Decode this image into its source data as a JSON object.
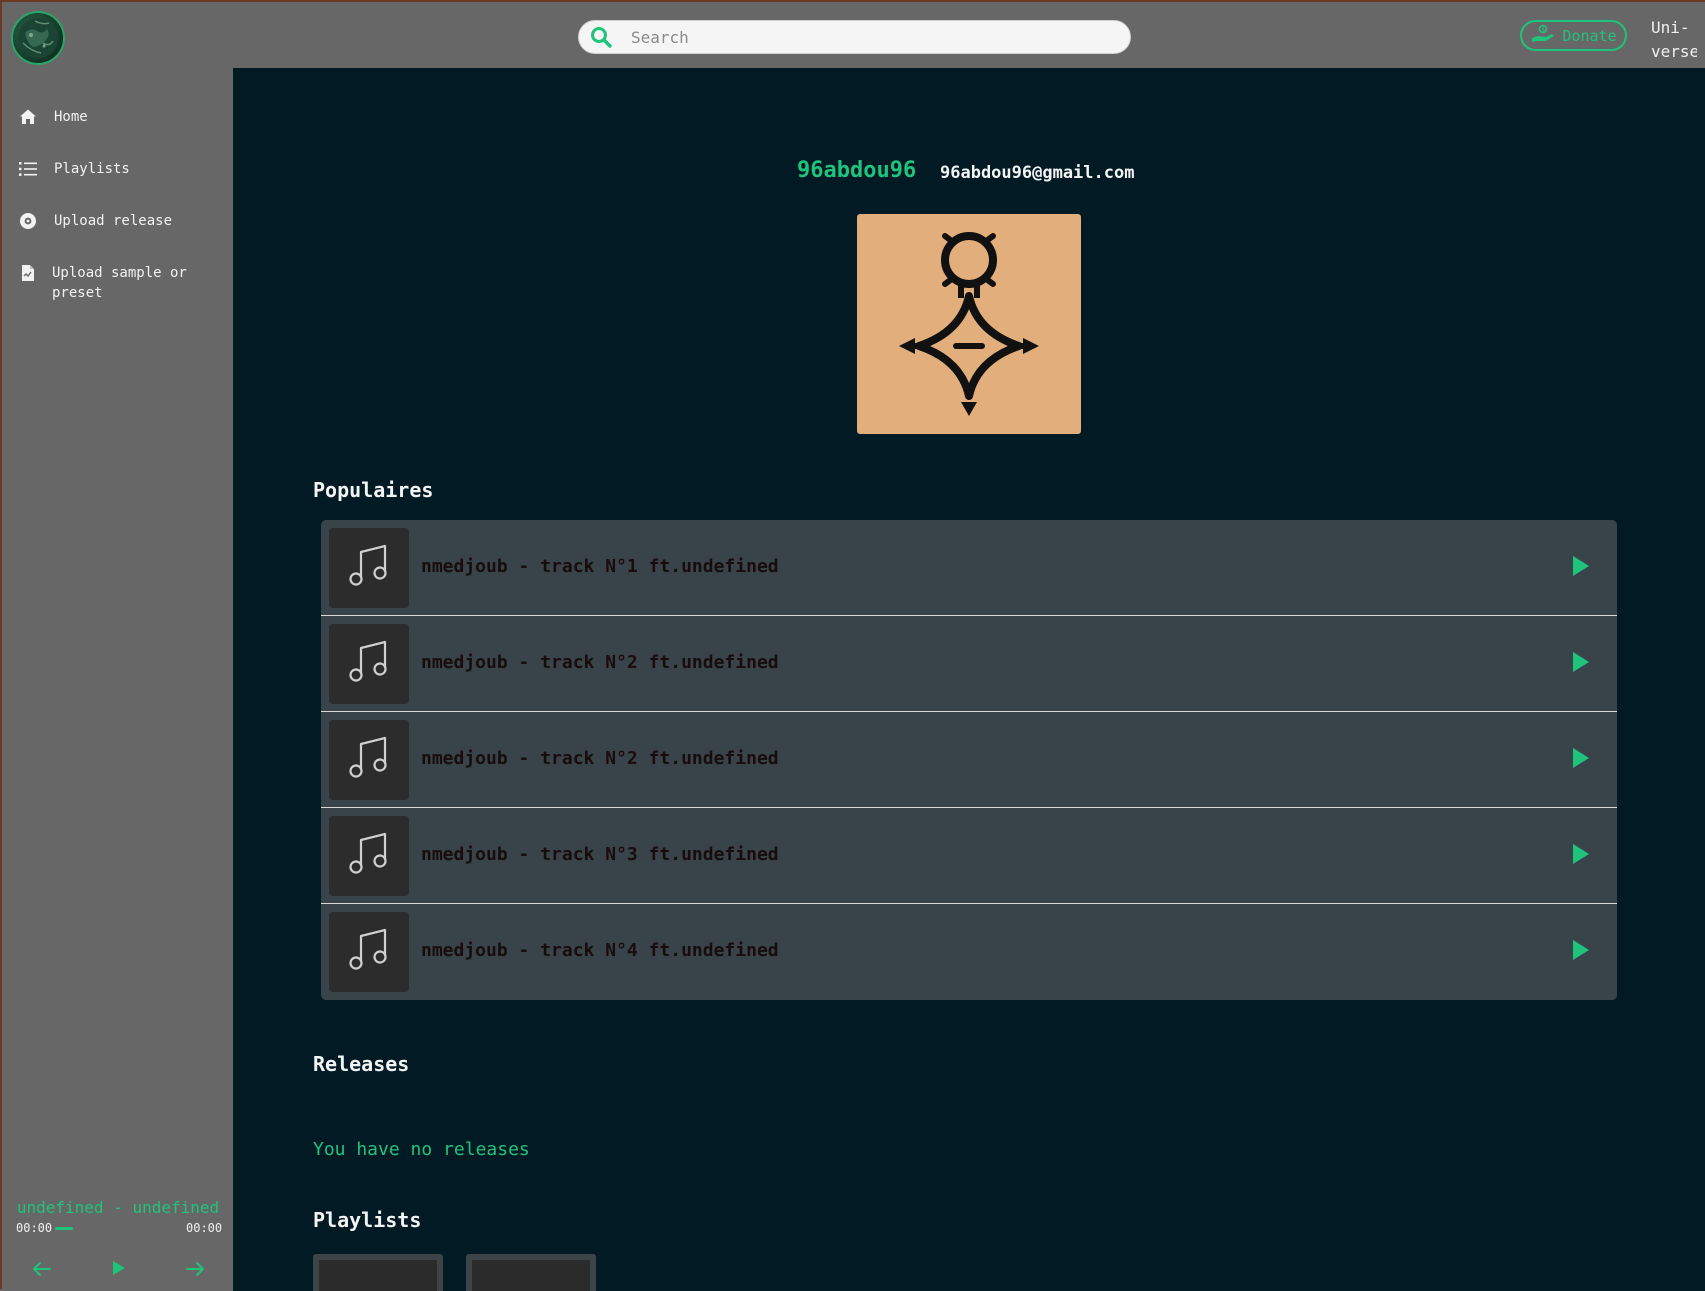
{
  "header": {
    "logo_icon": "globe-logo-icon",
    "search": {
      "placeholder": "Search",
      "value": "",
      "icon": "search-icon"
    },
    "donate_label": "Donate",
    "donate_icon": "hand-coin-icon",
    "universe_label": "Uni-\nverse"
  },
  "sidebar": {
    "items": [
      {
        "label": "Home",
        "icon": "home-icon"
      },
      {
        "label": "Playlists",
        "icon": "list-icon"
      },
      {
        "label": "Upload release",
        "icon": "disc-icon"
      },
      {
        "label": "Upload sample or preset",
        "icon": "file-upload-icon"
      }
    ]
  },
  "player": {
    "title": "undefined - undefined",
    "current_time": "00:00",
    "duration": "00:00",
    "progress": 0
  },
  "profile": {
    "username": "96abdou96",
    "email": "96abdou96@gmail.com",
    "avatar_icon": "tifinagh-yaz-symbol-icon"
  },
  "sections": {
    "popular_title": "Populaires",
    "releases_title": "Releases",
    "no_releases": "You have no releases",
    "playlists_title": "Playlists"
  },
  "tracks": [
    {
      "title": "nmedjoub - track N°1 ft.undefined"
    },
    {
      "title": "nmedjoub - track N°2 ft.undefined"
    },
    {
      "title": "nmedjoub - track N°2 ft.undefined"
    },
    {
      "title": "nmedjoub - track N°3 ft.undefined"
    },
    {
      "title": "nmedjoub - track N°4 ft.undefined"
    }
  ],
  "colors": {
    "accent": "#1fc47c",
    "main_bg": "#021a24",
    "sidebar_bg": "#676767",
    "track_bg": "#39444a",
    "avatar_bg": "#e1ae7c"
  }
}
